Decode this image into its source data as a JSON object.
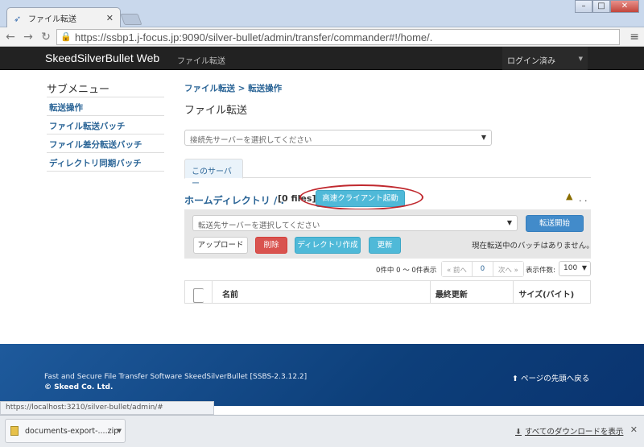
{
  "browser": {
    "tab_title": "ファイル転送",
    "url": "https://ssbp1.j-focus.jp:9090/silver-bullet/admin/transfer/commander#!/home/."
  },
  "navbar": {
    "brand": "SkeedSilverBullet Web",
    "link": "ファイル転送",
    "user_menu": "ログイン済み"
  },
  "sidebar": {
    "title": "サブメニュー",
    "items": [
      {
        "label": "転送操作"
      },
      {
        "label": "ファイル転送バッチ"
      },
      {
        "label": "ファイル差分転送バッチ"
      },
      {
        "label": "ディレクトリ同期バッチ"
      }
    ]
  },
  "main": {
    "breadcrumb": "ファイル転送 > 転送操作",
    "title": "ファイル転送",
    "server_select_placeholder": "接続先サーバーを選択してください",
    "tab": "このサーバー",
    "home_dir": "ホームディレクトリ / .",
    "file_count": "[0 files]",
    "fast_client_button": "高速クライアント起動",
    "parent_dir": ". .",
    "dest_select_placeholder": "転送先サーバーを選択してください",
    "start_button": "転送開始",
    "upload_button": "アップロード",
    "delete_button": "削除",
    "mkdir_button": "ディレクトリ作成",
    "refresh_button": "更新",
    "batch_status": "現在転送中のバッチはありません。",
    "pager_info": "0件中 0 〜 0件表示",
    "prev": "« 前へ",
    "page": "0",
    "next": "次へ »",
    "per_page_label": "表示件数:",
    "per_page_value": "100",
    "columns": [
      "名前",
      "最終更新",
      "サイズ(バイト)"
    ]
  },
  "footer": {
    "text": "Fast and Secure File Transfer Software SkeedSilverBullet [SSBS-2.3.12.2]",
    "copyright": "© Skeed Co. Ltd.",
    "back_to_top": "ページの先頭へ戻る"
  },
  "status_url": "https://localhost:3210/silver-bullet/admin/#",
  "downloads": {
    "item": "documents-export-....zip",
    "show_all": "すべてのダウンロードを表示"
  },
  "colors": {
    "link": "#2a6496",
    "navbar": "#222222",
    "footer": "#0d3f7a",
    "highlight_ellipse": "#c0282e"
  }
}
